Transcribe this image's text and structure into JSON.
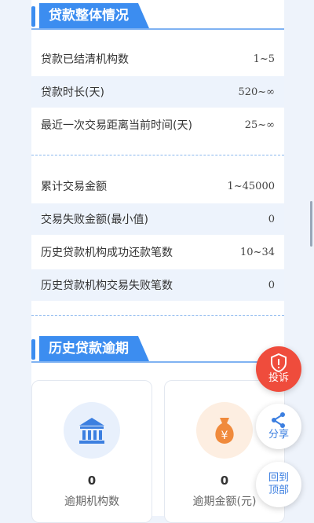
{
  "section_loan": {
    "title": "贷款整体情况",
    "rows": [
      {
        "label": "贷款已结清机构数",
        "value": "1~5"
      },
      {
        "label": "贷款时长(天)",
        "value": "520~∞"
      },
      {
        "label": "最近一次交易距离当前时间(天)",
        "value": "25~∞"
      },
      {
        "label": "累计交易金额",
        "value": "1~45000"
      },
      {
        "label": "交易失败金额(最小值)",
        "value": "0"
      },
      {
        "label": "历史贷款机构成功还款笔数",
        "value": "10~34"
      },
      {
        "label": "历史贷款机构交易失败笔数",
        "value": "0"
      }
    ]
  },
  "section_overdue": {
    "title": "历史贷款逾期",
    "tiles": [
      {
        "value": "0",
        "label": "逾期机构数",
        "icon": "bank-icon"
      },
      {
        "value": "0",
        "label": "逾期金额(元)",
        "icon": "money-bag-icon"
      }
    ]
  },
  "fabs": {
    "complaint": "投诉",
    "share": "分享",
    "back_top_line1": "回到",
    "back_top_line2": "顶部"
  },
  "colors": {
    "accent": "#3c8df0",
    "danger": "#ef4c3c",
    "money": "#f08a3c"
  }
}
